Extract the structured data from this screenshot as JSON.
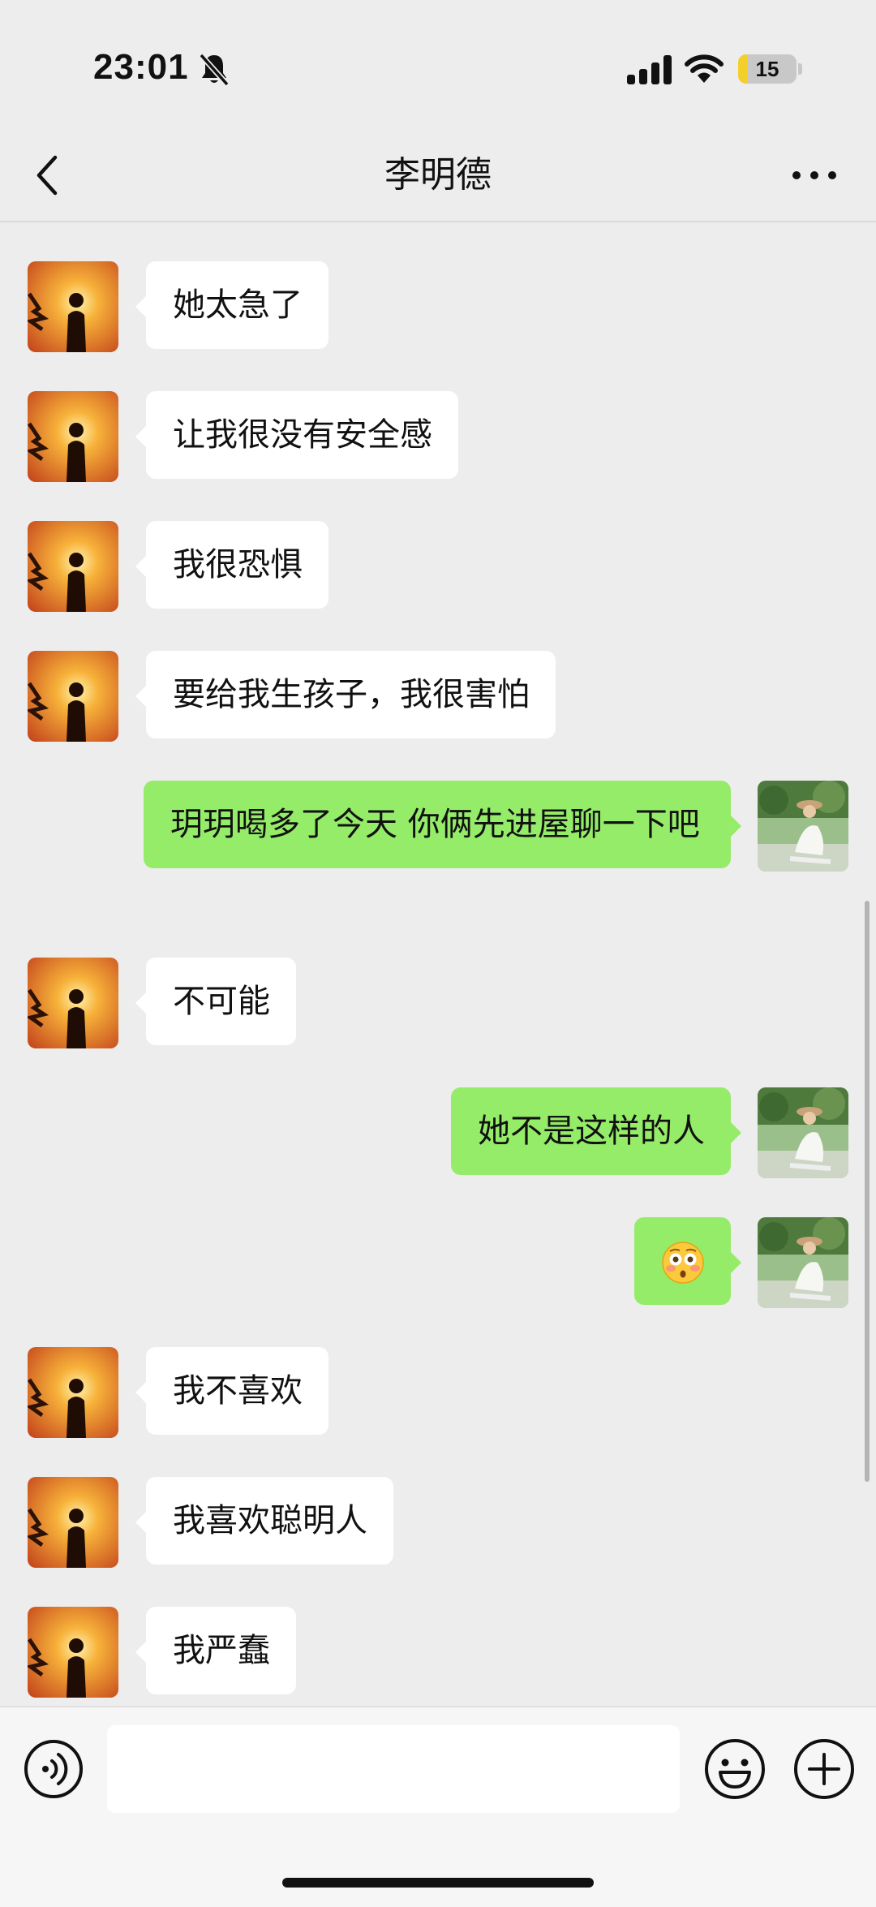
{
  "status_bar": {
    "time": "23:01",
    "battery_level": "15",
    "battery_fraction": 0.15
  },
  "header": {
    "title": "李明德"
  },
  "icons": {
    "back": "chevron-left-icon",
    "more": "more-dots-icon",
    "voice": "voice-icon",
    "emoji": "emoji-icon",
    "plus": "plus-icon",
    "bell": "bell-muted-icon",
    "signal": "cellular-signal-icon",
    "wifi": "wifi-icon"
  },
  "colors": {
    "incoming_bubble": "#ffffff",
    "outgoing_bubble": "#95ec69",
    "background": "#ededed"
  },
  "messages": [
    {
      "side": "in",
      "text": "她太急了"
    },
    {
      "side": "in",
      "text": "让我很没有安全感"
    },
    {
      "side": "in",
      "text": "我很恐惧"
    },
    {
      "side": "in",
      "text": "要给我生孩子，我很害怕"
    },
    {
      "side": "out",
      "text": "玥玥喝多了今天 你俩先进屋聊一下吧"
    },
    {
      "side": "in",
      "text": "不可能"
    },
    {
      "side": "out",
      "text": "她不是这样的人"
    },
    {
      "side": "out",
      "text": "",
      "emoji": "flushed-face-emoji"
    },
    {
      "side": "in",
      "text": "我不喜欢"
    },
    {
      "side": "in",
      "text": "我喜欢聪明人"
    },
    {
      "side": "in",
      "text": "我严蠢"
    }
  ],
  "input": {
    "value": "",
    "placeholder": ""
  }
}
